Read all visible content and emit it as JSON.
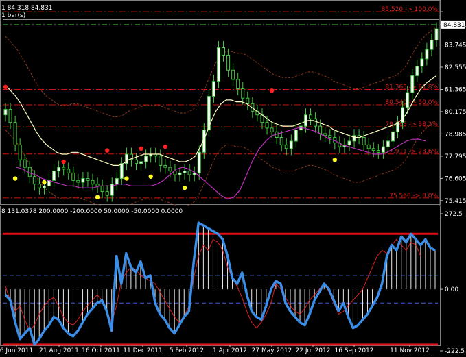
{
  "header": {
    "price_line": "1 84.318 84.831",
    "bars_line": "1 bar(s)"
  },
  "chart_data": [
    {
      "type": "candlestick",
      "price_axis_ticks": [
        85.52,
        84.831,
        83.745,
        82.555,
        81.365,
        80.175,
        78.985,
        77.795,
        76.605,
        75.415
      ],
      "ylim": [
        75.3,
        86.0
      ],
      "current_price": "84.831",
      "fib_levels": [
        {
          "price": 85.52,
          "label": "85.520 -> 100.0%"
        },
        {
          "price": 81.365,
          "label": "81.365 -> 61.8%"
        },
        {
          "price": 80.54,
          "label": "80.540 -> 50.0%"
        },
        {
          "price": 79.365,
          "label": "79.365 -> 38.2%"
        },
        {
          "price": 77.911,
          "label": "77.911 -> 23.6%"
        },
        {
          "price": 75.56,
          "label": "75.560 -> 0.0%"
        }
      ],
      "close": [
        80.3,
        79.6,
        78.4,
        77.6,
        77.2,
        76.7,
        76.3,
        76.1,
        76.2,
        76.5,
        77.0,
        77.2,
        77.1,
        76.9,
        76.5,
        76.4,
        76.6,
        76.5,
        76.3,
        76.2,
        75.9,
        75.7,
        76.3,
        76.6,
        77.4,
        77.9,
        77.6,
        77.4,
        77.5,
        77.8,
        77.9,
        77.8,
        77.3,
        77.2,
        77.0,
        76.8,
        76.9,
        77.0,
        76.8,
        76.9,
        78.0,
        79.2,
        81.0,
        81.8,
        83.6,
        83.2,
        82.4,
        81.9,
        81.4,
        80.9,
        80.6,
        80.2,
        80.0,
        79.6,
        79.3,
        79.1,
        78.8,
        78.4,
        78.2,
        78.6,
        79.2,
        79.4,
        80.0,
        79.8,
        79.4,
        79.0,
        78.9,
        78.8,
        78.5,
        78.3,
        78.4,
        78.6,
        78.9,
        78.8,
        78.4,
        78.2,
        78.1,
        78.0,
        78.3,
        78.6,
        79.1,
        79.6,
        80.4,
        81.2,
        82.1,
        82.6,
        83.0,
        83.5,
        84.0,
        84.6
      ],
      "ma_white": [
        81.6,
        81.3,
        81.0,
        80.6,
        80.1,
        79.6,
        79.1,
        78.7,
        78.4,
        78.2,
        78.0,
        77.9,
        77.9,
        78.0,
        78.0,
        77.9,
        77.8,
        77.7,
        77.6,
        77.5,
        77.4,
        77.3,
        77.3,
        77.4,
        77.6,
        77.7,
        77.8,
        77.9,
        77.9,
        77.9,
        77.9,
        77.8,
        77.7,
        77.6,
        77.5,
        77.5,
        77.6,
        77.8,
        78.3,
        78.9,
        79.6,
        80.2,
        80.6,
        80.8,
        80.8,
        80.7,
        80.7,
        80.6,
        80.4,
        80.2,
        80.0,
        79.8,
        79.6,
        79.5,
        79.4,
        79.4,
        79.4,
        79.5,
        79.6,
        79.7,
        79.7,
        79.6,
        79.5,
        79.4,
        79.2,
        79.1,
        79.0,
        78.9,
        78.8,
        78.8,
        78.9,
        79.0,
        79.1,
        79.2,
        79.3,
        79.4,
        79.5,
        79.7,
        80.0,
        80.5,
        81.0,
        81.4,
        81.7,
        81.9,
        82.1
      ],
      "ma_purple": [
        77.2,
        77.1,
        76.9,
        76.8,
        76.6,
        76.5,
        76.4,
        76.3,
        76.2,
        76.2,
        76.1,
        76.1,
        76.1,
        76.2,
        76.2,
        76.2,
        76.3,
        76.3,
        76.2,
        76.2,
        76.2,
        76.2,
        76.3,
        76.5,
        76.8,
        77.1,
        77.2,
        77.1,
        76.9,
        76.6,
        76.3,
        76.0,
        75.7,
        75.5,
        75.6,
        76.0,
        76.8,
        77.6,
        78.2,
        78.6,
        78.9,
        79.0,
        79.1,
        79.2,
        79.3,
        79.3,
        79.2,
        79.1,
        78.9,
        78.7,
        78.6,
        78.4,
        78.3,
        78.2,
        78.1,
        78.0,
        77.9,
        77.9,
        78.0,
        78.2,
        78.4,
        78.6,
        78.7,
        78.7,
        78.6
      ],
      "markers_red": [
        [
          0,
          81.5
        ],
        [
          12,
          77.5
        ],
        [
          21,
          78.1
        ],
        [
          28,
          78.2
        ],
        [
          33,
          78.3
        ],
        [
          55,
          81.3
        ]
      ],
      "markers_yellow": [
        [
          2,
          76.6
        ],
        [
          8,
          76.4
        ],
        [
          19,
          75.6
        ],
        [
          25,
          76.6
        ],
        [
          30,
          76.7
        ],
        [
          37,
          76.1
        ],
        [
          68,
          77.6
        ]
      ]
    },
    {
      "type": "line",
      "header": "8 131.0378 200.0000 -200.0000 50.0000 -50.0000 0.0000",
      "y_ticks": [
        "272.5",
        "0.00",
        "-222.5"
      ],
      "ylim": [
        -222.5,
        272.5
      ],
      "levels": [
        200,
        50,
        -50,
        -200
      ],
      "x_tick_labels": [
        "6 Jun 2011",
        "21 Aug 2011",
        "16 Oct 2011",
        "11 Dec 2011",
        "5 Feb 2012",
        "1 Apr 2012",
        "27 May 2012",
        "22 Jul 2012",
        "16 Sep 2012",
        "11 Nov 2012"
      ],
      "blue": [
        -20,
        -40,
        -120,
        -180,
        -160,
        -140,
        -200,
        -180,
        -150,
        -130,
        -100,
        -110,
        -140,
        -160,
        -170,
        -150,
        -120,
        -90,
        -70,
        -50,
        -40,
        -80,
        -150,
        120,
        20,
        130,
        80,
        60,
        100,
        40,
        50,
        -50,
        -90,
        -110,
        -140,
        -160,
        -130,
        -100,
        -80,
        100,
        240,
        230,
        220,
        210,
        200,
        180,
        120,
        40,
        20,
        60,
        -20,
        -80,
        -100,
        -110,
        -60,
        0,
        30,
        20,
        -50,
        -80,
        -100,
        -120,
        -130,
        -90,
        -40,
        -10,
        20,
        0,
        -40,
        -80,
        -50,
        -100,
        -140,
        -130,
        -110,
        -90,
        -60,
        -30,
        20,
        120,
        160,
        140,
        190,
        170,
        200,
        180,
        160,
        180,
        150,
        140
      ],
      "red": [
        10,
        -40,
        -80,
        -60,
        -110,
        -150,
        -130,
        -90,
        -60,
        -40,
        -30,
        -60,
        -100,
        -120,
        -130,
        -110,
        -80,
        -60,
        -40,
        -20,
        -40,
        -80,
        -120,
        -60,
        30,
        60,
        80,
        70,
        50,
        40,
        30,
        20,
        -10,
        -40,
        -70,
        -100,
        -120,
        -100,
        -60,
        40,
        120,
        160,
        140,
        180,
        170,
        140,
        80,
        40,
        10,
        -30,
        -80,
        -120,
        -140,
        -120,
        -90,
        -50,
        20,
        0,
        -30,
        -60,
        -80,
        -90,
        -70,
        -40,
        -20,
        0,
        20,
        -10,
        -50,
        -90,
        -80,
        -60,
        -40,
        -20,
        0,
        40,
        80,
        120,
        140,
        130,
        160,
        180,
        160,
        140,
        170,
        160,
        120
      ]
    }
  ]
}
